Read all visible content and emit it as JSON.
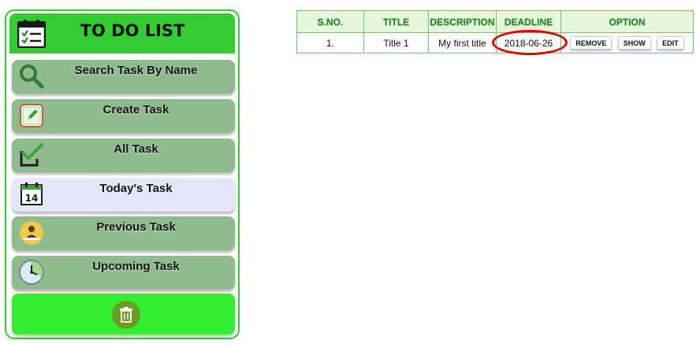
{
  "app": {
    "title": "TO DO LIST",
    "header_icon": "checklist-icon"
  },
  "sidebar": {
    "items": [
      {
        "label": "Search Task By Name",
        "icon": "search-icon",
        "active": false
      },
      {
        "label": "Create Task",
        "icon": "pencil-icon",
        "active": false
      },
      {
        "label": "All Task",
        "icon": "checkbox-icon",
        "active": false
      },
      {
        "label": "Today's Task",
        "icon": "calendar-icon",
        "active": true
      },
      {
        "label": "Previous Task",
        "icon": "person-at-desk-icon",
        "active": false
      },
      {
        "label": "Upcoming Task",
        "icon": "clock-icon",
        "active": false
      }
    ],
    "trash_icon": "trash-icon"
  },
  "table": {
    "headers": [
      "S.NO.",
      "TITLE",
      "DESCRIPTION",
      "DEADLINE",
      "OPTION"
    ],
    "rows": [
      {
        "sno": "1.",
        "title": "Title 1",
        "description": "My first title",
        "deadline": "2018-06-26",
        "options": {
          "remove": "REMOVE",
          "show": "SHOW",
          "edit": "EDIT"
        }
      }
    ]
  },
  "colors": {
    "header_green": "#33cc33",
    "menu_item": "#8fbc8f",
    "menu_item_active": "#e6e6fa",
    "trash_bar": "#33ee33",
    "table_header_bg": "#e6f6dc",
    "table_header_text": "#1e8a1e",
    "highlight_circle": "#e00000"
  }
}
